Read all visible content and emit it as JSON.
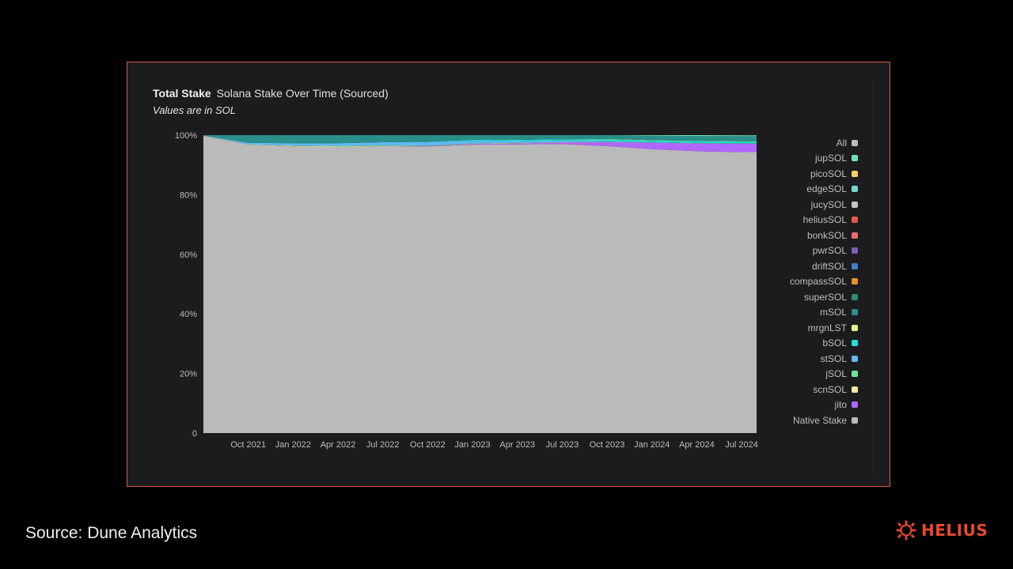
{
  "title": "Total Stake",
  "subtitle_name": "Solana Stake Over Time (Sourced)",
  "note": "Values are in SOL",
  "source": "Source: Dune Analytics",
  "brand": "HELIUS",
  "colors": {
    "border": "#d9574a",
    "brand": "#e8492f",
    "panel": "#1c1c1e"
  },
  "chart_data": {
    "type": "area",
    "stacked": true,
    "normalized": true,
    "title": "Total Stake",
    "subtitle": "Solana Stake Over Time (Sourced)",
    "xlabel": "",
    "ylabel": "",
    "ylim": [
      0,
      100
    ],
    "y_ticks": [
      "0",
      "20%",
      "40%",
      "60%",
      "80%",
      "100%"
    ],
    "x_ticks": [
      "Oct 2021",
      "Jan 2022",
      "Apr 2022",
      "Jul 2022",
      "Oct 2022",
      "Jan 2023",
      "Apr 2023",
      "Jul 2023",
      "Oct 2023",
      "Jan 2024",
      "Apr 2024",
      "Jul 2024"
    ],
    "x_range": [
      "Jul 2021",
      "Aug 2024"
    ],
    "x": [
      "Jul 2021",
      "Oct 2021",
      "Jan 2022",
      "Apr 2022",
      "Jul 2022",
      "Oct 2022",
      "Jan 2023",
      "Apr 2023",
      "Jul 2023",
      "Oct 2023",
      "Jan 2024",
      "Apr 2024",
      "Jul 2024",
      "Aug 2024"
    ],
    "legend": [
      "All",
      "jupSOL",
      "picoSOL",
      "edgeSOL",
      "jucySOL",
      "heliusSOL",
      "bonkSOL",
      "pwrSOL",
      "driftSOL",
      "compassSOL",
      "superSOL",
      "mSOL",
      "mrgnLST",
      "bSOL",
      "stSOL",
      "jSOL",
      "scnSOL",
      "jito",
      "Native Stake"
    ],
    "legend_colors": [
      "#bdbdbd",
      "#6fe3b8",
      "#f3d26b",
      "#7ad7d0",
      "#c4c4c4",
      "#e05a4a",
      "#ea6f6f",
      "#7b5fb8",
      "#3f7fc6",
      "#e8902a",
      "#2f8c77",
      "#2a8f88",
      "#e6ef85",
      "#1fe0d0",
      "#63b8f5",
      "#6fe39a",
      "#f5e6a6",
      "#b066ff",
      "#bdbdbd"
    ],
    "legend_position": "right",
    "grid": false,
    "series": [
      {
        "name": "Native Stake",
        "color": "#bababa",
        "values": [
          99.8,
          96.6,
          96.2,
          96.0,
          96.3,
          96.2,
          96.8,
          96.9,
          97.0,
          96.3,
          95.3,
          94.6,
          94.3,
          94.3
        ]
      },
      {
        "name": "jito",
        "color": "#b066ff",
        "values": [
          0.0,
          0.0,
          0.0,
          0.0,
          0.0,
          0.1,
          0.2,
          0.3,
          0.5,
          1.3,
          2.1,
          2.6,
          2.8,
          2.8
        ]
      },
      {
        "name": "scnSOL",
        "color": "#f5e6a6",
        "values": [
          0.05,
          0.2,
          0.2,
          0.2,
          0.1,
          0.1,
          0.1,
          0.1,
          0.1,
          0.1,
          0.05,
          0.05,
          0.05,
          0.05
        ]
      },
      {
        "name": "jSOL",
        "color": "#6fe39a",
        "values": [
          0.0,
          0.0,
          0.1,
          0.2,
          0.2,
          0.1,
          0.1,
          0.1,
          0.1,
          0.1,
          0.05,
          0.05,
          0.05,
          0.05
        ]
      },
      {
        "name": "stSOL",
        "color": "#63b8f5",
        "values": [
          0.05,
          0.6,
          0.8,
          0.9,
          1.0,
          1.2,
          0.9,
          0.6,
          0.5,
          0.3,
          0.2,
          0.1,
          0.05,
          0.05
        ]
      },
      {
        "name": "bSOL",
        "color": "#1fe0d0",
        "values": [
          0.0,
          0.0,
          0.0,
          0.0,
          0.0,
          0.1,
          0.3,
          0.4,
          0.4,
          0.5,
          0.5,
          0.6,
          0.6,
          0.6
        ]
      },
      {
        "name": "mrgnLST",
        "color": "#e6ef85",
        "values": [
          0.0,
          0.0,
          0.0,
          0.0,
          0.0,
          0.0,
          0.0,
          0.0,
          0.0,
          0.1,
          0.1,
          0.1,
          0.1,
          0.1
        ]
      },
      {
        "name": "mSOL",
        "color": "#2a8f88",
        "values": [
          0.1,
          2.6,
          2.7,
          2.7,
          2.4,
          2.2,
          1.6,
          1.6,
          1.4,
          1.3,
          1.5,
          1.6,
          1.7,
          1.7
        ]
      },
      {
        "name": "jupSOL",
        "color": "#6fe3b8",
        "values": [
          0.0,
          0.0,
          0.0,
          0.0,
          0.0,
          0.0,
          0.0,
          0.0,
          0.0,
          0.0,
          0.2,
          0.3,
          0.3,
          0.3
        ]
      }
    ]
  }
}
